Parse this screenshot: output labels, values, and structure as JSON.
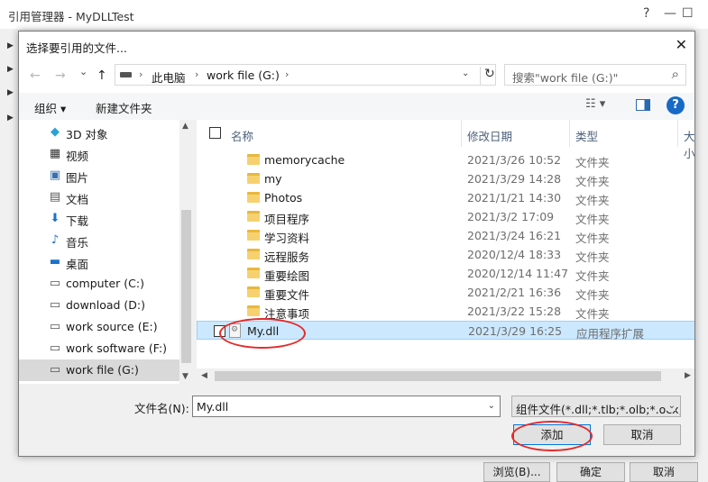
{
  "background_window": {
    "title": "引用管理器 - MyDLLTest",
    "controls": {
      "help": "?",
      "minimize": "—",
      "maximize": "☐"
    },
    "buttons": {
      "browse": "浏览(B)...",
      "ok": "确定",
      "cancel": "取消"
    }
  },
  "dialog": {
    "title": "选择要引用的文件...",
    "close": "✕",
    "nav": {
      "back": "←",
      "forward": "→",
      "recent": "⌄",
      "up": "↑"
    },
    "address": {
      "parts": [
        "此电脑",
        "work file (G:)"
      ],
      "separator": "›",
      "dropdown": "⌄",
      "refresh": "↻"
    },
    "search": {
      "placeholder": "搜索\"work file (G:)\"",
      "icon": "⌕"
    },
    "toolbar": {
      "organize": "组织 ▾",
      "new_folder": "新建文件夹",
      "view_options": "☷ ▾",
      "help": "?"
    },
    "nav_pane": {
      "items": [
        {
          "label": "3D 对象",
          "icon": "3d-objects-icon",
          "glyph": "◆",
          "color": "#2aa2d6"
        },
        {
          "label": "视频",
          "icon": "video-icon",
          "glyph": "▦",
          "color": "#333333"
        },
        {
          "label": "图片",
          "icon": "pictures-icon",
          "glyph": "▣",
          "color": "#3a6fb0"
        },
        {
          "label": "文档",
          "icon": "documents-icon",
          "glyph": "▤",
          "color": "#555555"
        },
        {
          "label": "下载",
          "icon": "downloads-icon",
          "glyph": "⬇",
          "color": "#1d72c9"
        },
        {
          "label": "音乐",
          "icon": "music-icon",
          "glyph": "♪",
          "color": "#1d72c9"
        },
        {
          "label": "桌面",
          "icon": "desktop-icon",
          "glyph": "▬",
          "color": "#1d72c9"
        },
        {
          "label": "computer (C:)",
          "icon": "drive-icon",
          "glyph": "▭",
          "color": "#555555"
        },
        {
          "label": "download (D:)",
          "icon": "drive-icon",
          "glyph": "▭",
          "color": "#555555"
        },
        {
          "label": "work source (E:)",
          "icon": "drive-icon",
          "glyph": "▭",
          "color": "#555555"
        },
        {
          "label": "work software (F:)",
          "icon": "drive-icon",
          "glyph": "▭",
          "color": "#555555"
        },
        {
          "label": "work file (G:)",
          "icon": "drive-icon",
          "glyph": "▭",
          "color": "#555555",
          "selected": true
        }
      ]
    },
    "columns": {
      "name": "名称",
      "date": "修改日期",
      "type": "类型",
      "size": "大小"
    },
    "files": [
      {
        "name": "memorycache",
        "date": "2021/3/26 10:52",
        "type": "文件夹",
        "kind": "folder"
      },
      {
        "name": "my",
        "date": "2021/3/29 14:28",
        "type": "文件夹",
        "kind": "folder"
      },
      {
        "name": "Photos",
        "date": "2021/1/21 14:30",
        "type": "文件夹",
        "kind": "folder"
      },
      {
        "name": "项目程序",
        "date": "2021/3/2 17:09",
        "type": "文件夹",
        "kind": "folder"
      },
      {
        "name": "学习资料",
        "date": "2021/3/24 16:21",
        "type": "文件夹",
        "kind": "folder"
      },
      {
        "name": "远程服务",
        "date": "2020/12/4 18:33",
        "type": "文件夹",
        "kind": "folder"
      },
      {
        "name": "重要绘图",
        "date": "2020/12/14 11:47",
        "type": "文件夹",
        "kind": "folder"
      },
      {
        "name": "重要文件",
        "date": "2021/2/21 16:36",
        "type": "文件夹",
        "kind": "folder"
      },
      {
        "name": "注意事项",
        "date": "2021/3/22 15:28",
        "type": "文件夹",
        "kind": "folder"
      },
      {
        "name": "My.dll",
        "date": "2021/3/29 16:25",
        "type": "应用程序扩展",
        "kind": "dll",
        "selected": true
      }
    ],
    "filename": {
      "label": "文件名(N):",
      "value": "My.dll",
      "dropdown": "⌄"
    },
    "filetype": {
      "value": "组件文件(*.dll;*.tlb;*.olb;*.ocx;",
      "dropdown": "⌄"
    },
    "buttons": {
      "add": "添加",
      "cancel": "取消"
    },
    "annotation_color": "#e52b2b",
    "accent_color": "#0078d7"
  }
}
